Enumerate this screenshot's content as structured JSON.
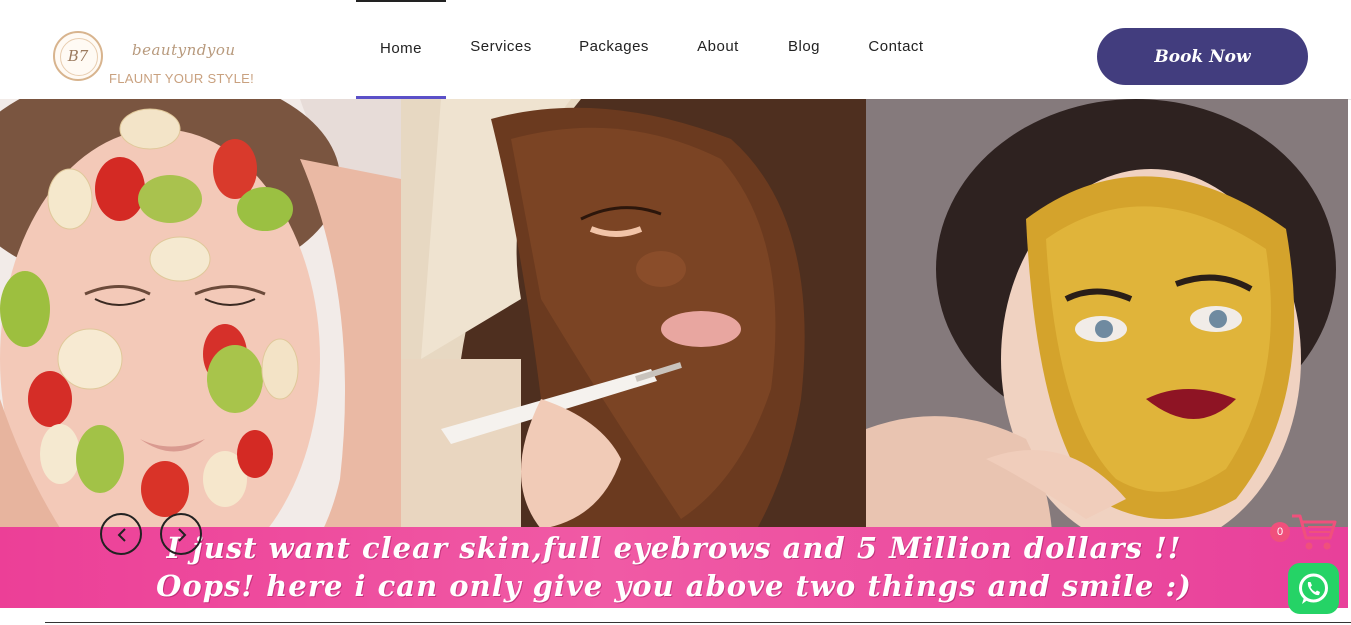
{
  "brand": {
    "monogram": "B7",
    "name": "beautyndyou",
    "tagline": "FLAUNT YOUR STYLE!"
  },
  "nav": {
    "items": [
      {
        "label": "Home",
        "active": true
      },
      {
        "label": "Services",
        "active": false
      },
      {
        "label": "Packages",
        "active": false
      },
      {
        "label": "About",
        "active": false
      },
      {
        "label": "Blog",
        "active": false
      },
      {
        "label": "Contact",
        "active": false
      }
    ]
  },
  "cta": {
    "book_label": "Book Now"
  },
  "hero": {
    "banner_line1": "I just want clear skin,full eyebrows and 5 Million dollars !!",
    "banner_line2": "Oops! here i can only give you above two things and smile :)",
    "slides": [
      "fruit facial mask",
      "chocolate facial mask",
      "gold facial mask"
    ]
  },
  "widgets": {
    "cart_count": "0",
    "cart_icon": "shopping-cart-icon",
    "whatsapp_icon": "whatsapp-icon",
    "prev_icon": "chevron-left-icon",
    "next_icon": "chevron-right-icon"
  },
  "colors": {
    "accent": "#423d7e",
    "nav_active_underline": "#5b50c8",
    "banner_pink": "#ec3f97",
    "tagline": "#c9a17f",
    "whatsapp": "#25d366",
    "cart": "#f0507c"
  }
}
